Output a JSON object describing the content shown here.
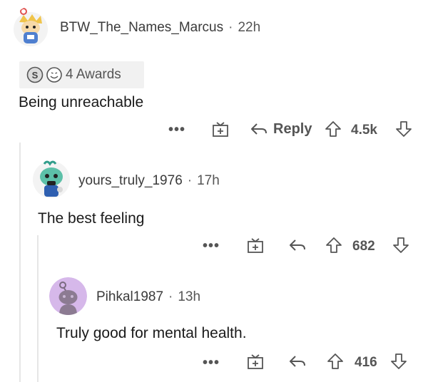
{
  "comments": [
    {
      "username": "BTW_The_Names_Marcus",
      "separator": "·",
      "time": "22h",
      "awards": {
        "label": "4 Awards",
        "icons": [
          "silver-award-icon",
          "wholesome-award-icon"
        ]
      },
      "text": "Being unreachable",
      "actions": {
        "more": "•••",
        "reply_label": "Reply",
        "score": "4.5k"
      }
    },
    {
      "username": "yours_truly_1976",
      "separator": "·",
      "time": "17h",
      "text": "The best feeling",
      "actions": {
        "more": "•••",
        "score": "682"
      }
    },
    {
      "username": "Pihkal1987",
      "separator": "·",
      "time": "13h",
      "text": "Truly good for mental health.",
      "actions": {
        "more": "•••",
        "score": "416"
      }
    }
  ],
  "colors": {
    "text": "#1c1c1c",
    "muted": "#555555",
    "award_bg": "#f1f1f1",
    "thread_line": "#e6e6e6",
    "avatar_purple": "#d6b8ea"
  }
}
